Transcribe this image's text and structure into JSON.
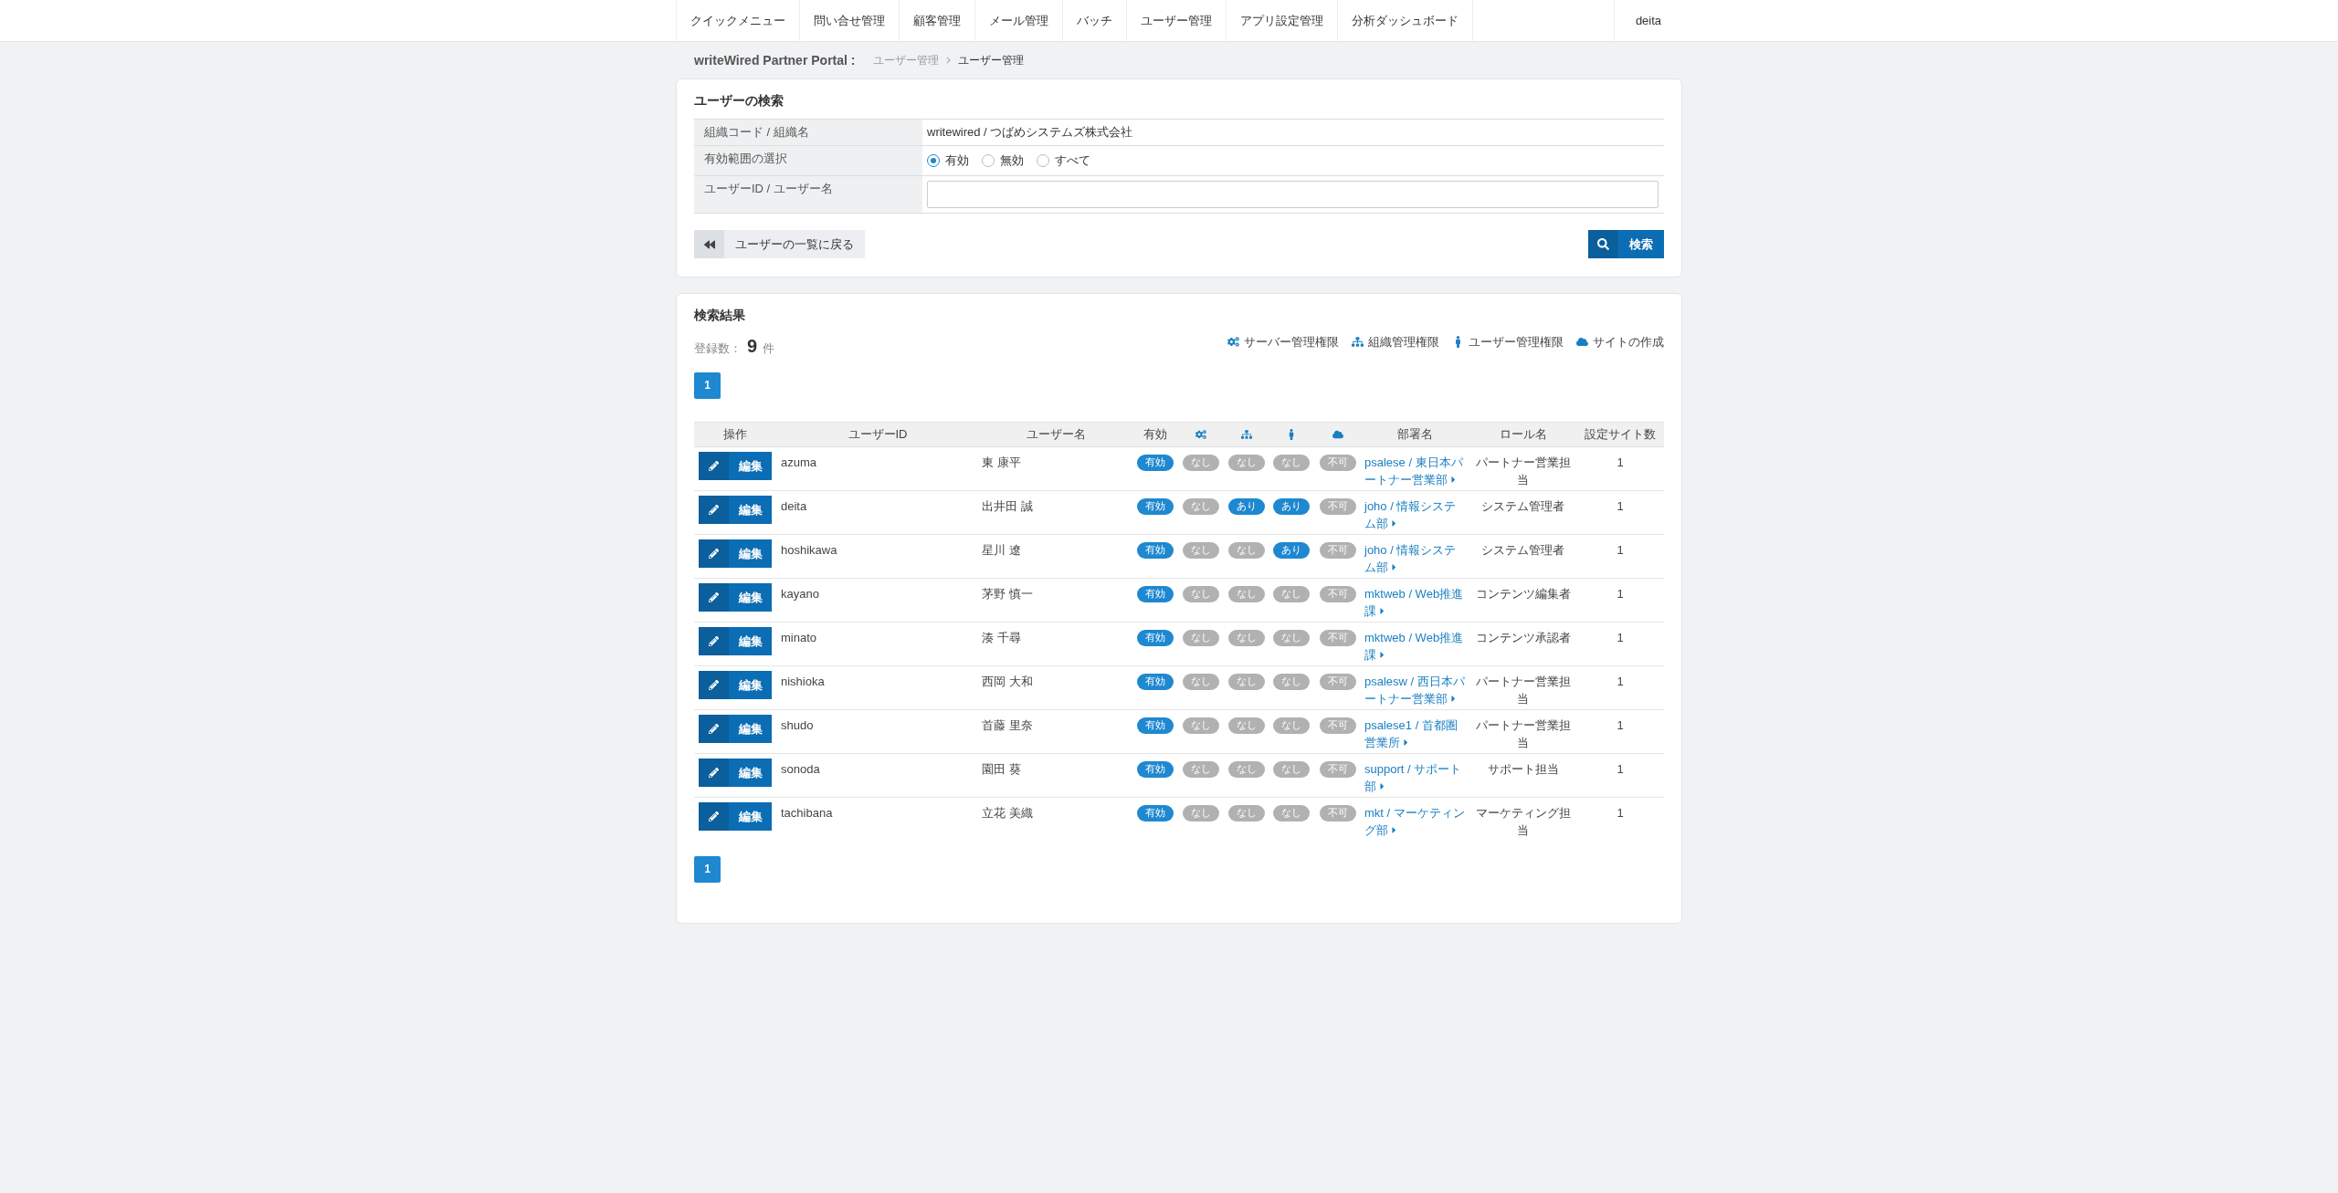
{
  "nav": {
    "items": [
      "クイックメニュー",
      "問い合せ管理",
      "顧客管理",
      "メール管理",
      "バッチ",
      "ユーザー管理",
      "アプリ設定管理",
      "分析ダッシュボード"
    ],
    "user": "deita"
  },
  "breadcrumb": {
    "portal": "writeWired Partner Portal :",
    "items": [
      {
        "label": "ユーザー管理",
        "current": false
      },
      {
        "label": "ユーザー管理",
        "current": true
      }
    ]
  },
  "search": {
    "title": "ユーザーの検索",
    "rows": [
      {
        "kind": "text",
        "label": "組織コード / 組織名",
        "value": "writewired / つばめシステムズ株式会社"
      },
      {
        "kind": "radio",
        "label": "有効範囲の選択",
        "options": [
          {
            "label": "有効",
            "selected": true
          },
          {
            "label": "無効",
            "selected": false
          },
          {
            "label": "すべて",
            "selected": false
          }
        ]
      },
      {
        "kind": "input",
        "label": "ユーザーID / ユーザー名"
      }
    ],
    "back_button": "ユーザーの一覧に戻る",
    "search_button": "検索"
  },
  "results": {
    "title": "検索結果",
    "count_label": "登録数：",
    "count": "9",
    "count_unit": "件",
    "legend": [
      {
        "kind": "server",
        "label": "サーバー管理権限"
      },
      {
        "kind": "org",
        "label": "組織管理権限"
      },
      {
        "kind": "user",
        "label": "ユーザー管理権限"
      },
      {
        "kind": "site",
        "label": "サイトの作成"
      }
    ],
    "pagination_top": [
      {
        "label": "1",
        "selected": true
      }
    ],
    "columns": [
      {
        "kind": "text",
        "label": "操作"
      },
      {
        "kind": "text",
        "label": "ユーザーID"
      },
      {
        "kind": "text",
        "label": "ユーザー名"
      },
      {
        "kind": "text",
        "label": "有効"
      },
      {
        "kind": "server"
      },
      {
        "kind": "org"
      },
      {
        "kind": "user"
      },
      {
        "kind": "site"
      },
      {
        "kind": "text",
        "label": "部署名"
      },
      {
        "kind": "text",
        "label": "ロール名"
      },
      {
        "kind": "text",
        "label": "設定サイト数"
      }
    ],
    "rows": [
      {
        "edit_button": "編集",
        "user_id": "azuma",
        "user_name": "東 康平",
        "active": {
          "label": "有効",
          "on": true
        },
        "server_admin": {
          "label": "なし",
          "on": false
        },
        "org_admin": {
          "label": "なし",
          "on": false
        },
        "user_admin": {
          "label": "なし",
          "on": false
        },
        "site_create": {
          "label": "不可",
          "on": false
        },
        "department": "psalese / 東日本パートナー営業部",
        "role": "パートナー営業担当",
        "sites": "1"
      },
      {
        "edit_button": "編集",
        "user_id": "deita",
        "user_name": "出井田 誠",
        "active": {
          "label": "有効",
          "on": true
        },
        "server_admin": {
          "label": "なし",
          "on": false
        },
        "org_admin": {
          "label": "あり",
          "on": true
        },
        "user_admin": {
          "label": "あり",
          "on": true
        },
        "site_create": {
          "label": "不可",
          "on": false
        },
        "department": "joho / 情報システム部",
        "role": "システム管理者",
        "sites": "1"
      },
      {
        "edit_button": "編集",
        "user_id": "hoshikawa",
        "user_name": "星川 遼",
        "active": {
          "label": "有効",
          "on": true
        },
        "server_admin": {
          "label": "なし",
          "on": false
        },
        "org_admin": {
          "label": "なし",
          "on": false
        },
        "user_admin": {
          "label": "あり",
          "on": true
        },
        "site_create": {
          "label": "不可",
          "on": false
        },
        "department": "joho / 情報システム部",
        "role": "システム管理者",
        "sites": "1"
      },
      {
        "edit_button": "編集",
        "user_id": "kayano",
        "user_name": "茅野 慎一",
        "active": {
          "label": "有効",
          "on": true
        },
        "server_admin": {
          "label": "なし",
          "on": false
        },
        "org_admin": {
          "label": "なし",
          "on": false
        },
        "user_admin": {
          "label": "なし",
          "on": false
        },
        "site_create": {
          "label": "不可",
          "on": false
        },
        "department": "mktweb / Web推進課",
        "role": "コンテンツ編集者",
        "sites": "1"
      },
      {
        "edit_button": "編集",
        "user_id": "minato",
        "user_name": "湊 千尋",
        "active": {
          "label": "有効",
          "on": true
        },
        "server_admin": {
          "label": "なし",
          "on": false
        },
        "org_admin": {
          "label": "なし",
          "on": false
        },
        "user_admin": {
          "label": "なし",
          "on": false
        },
        "site_create": {
          "label": "不可",
          "on": false
        },
        "department": "mktweb / Web推進課",
        "role": "コンテンツ承認者",
        "sites": "1"
      },
      {
        "edit_button": "編集",
        "user_id": "nishioka",
        "user_name": "西岡 大和",
        "active": {
          "label": "有効",
          "on": true
        },
        "server_admin": {
          "label": "なし",
          "on": false
        },
        "org_admin": {
          "label": "なし",
          "on": false
        },
        "user_admin": {
          "label": "なし",
          "on": false
        },
        "site_create": {
          "label": "不可",
          "on": false
        },
        "department": "psalesw / 西日本パートナー営業部",
        "role": "パートナー営業担当",
        "sites": "1"
      },
      {
        "edit_button": "編集",
        "user_id": "shudo",
        "user_name": "首藤 里奈",
        "active": {
          "label": "有効",
          "on": true
        },
        "server_admin": {
          "label": "なし",
          "on": false
        },
        "org_admin": {
          "label": "なし",
          "on": false
        },
        "user_admin": {
          "label": "なし",
          "on": false
        },
        "site_create": {
          "label": "不可",
          "on": false
        },
        "department": "psalese1 / 首都圏営業所",
        "role": "パートナー営業担当",
        "sites": "1"
      },
      {
        "edit_button": "編集",
        "user_id": "sonoda",
        "user_name": "園田 葵",
        "active": {
          "label": "有効",
          "on": true
        },
        "server_admin": {
          "label": "なし",
          "on": false
        },
        "org_admin": {
          "label": "なし",
          "on": false
        },
        "user_admin": {
          "label": "なし",
          "on": false
        },
        "site_create": {
          "label": "不可",
          "on": false
        },
        "department": "support / サポート部",
        "role": "サポート担当",
        "sites": "1"
      },
      {
        "edit_button": "編集",
        "user_id": "tachibana",
        "user_name": "立花 美織",
        "active": {
          "label": "有効",
          "on": true
        },
        "server_admin": {
          "label": "なし",
          "on": false
        },
        "org_admin": {
          "label": "なし",
          "on": false
        },
        "user_admin": {
          "label": "なし",
          "on": false
        },
        "site_create": {
          "label": "不可",
          "on": false
        },
        "department": "mkt / マーケティング部",
        "role": "マーケティング担当",
        "sites": "1"
      }
    ],
    "pagination_bottom": [
      {
        "label": "1",
        "selected": true
      }
    ]
  }
}
